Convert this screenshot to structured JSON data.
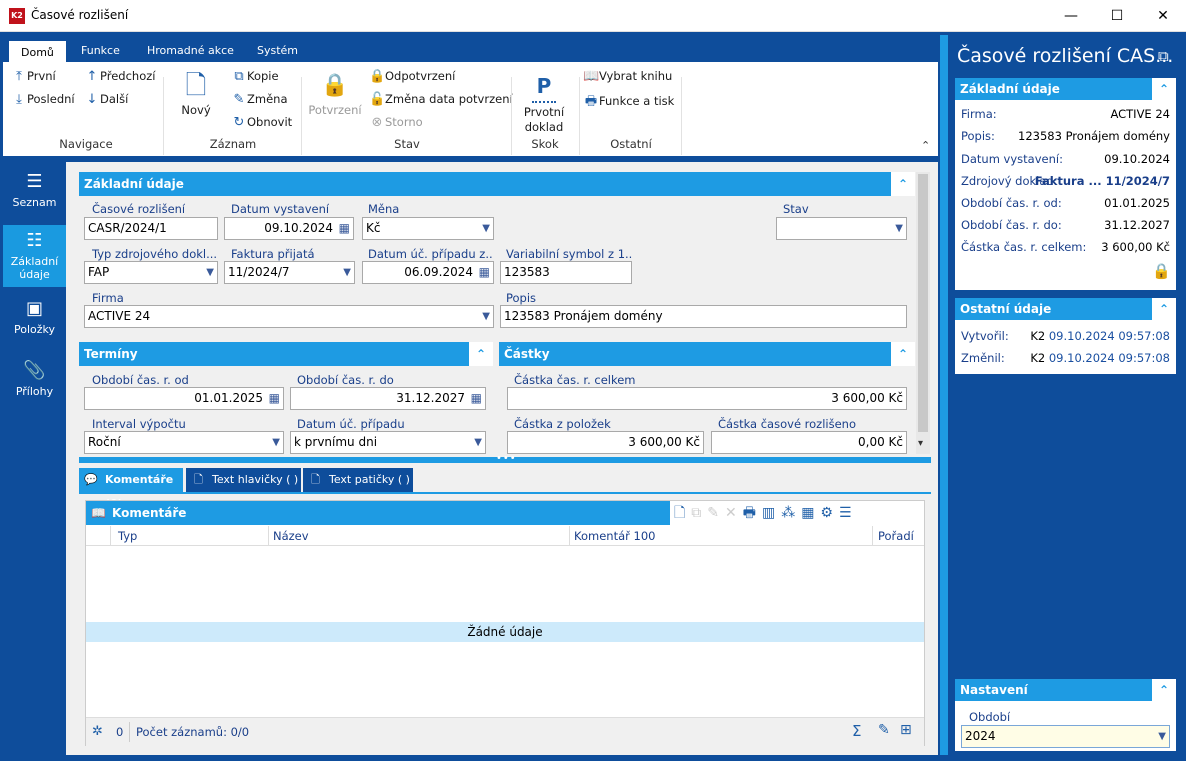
{
  "window": {
    "title": "Časové rozlišení",
    "logo_text": "K2",
    "minimize": "—",
    "maximize": "☐",
    "close": "✕"
  },
  "ribbon": {
    "tabs": [
      {
        "label": "Domů"
      },
      {
        "label": "Funkce"
      },
      {
        "label": "Hromadné akce"
      },
      {
        "label": "Systém"
      }
    ],
    "groups": {
      "navigace": {
        "label": "Navigace",
        "first": "První",
        "last": "Poslední",
        "prev": "Předchozí",
        "next": "Další"
      },
      "zaznam": {
        "label": "Záznam",
        "new": "Nový",
        "copy": "Kopie",
        "change": "Změna",
        "refresh": "Obnovit"
      },
      "stav": {
        "label": "Stav",
        "confirm": "Potvrzení",
        "unconfirm": "Odpotvrzení",
        "change_date": "Změna data potvrzení",
        "storno": "Storno"
      },
      "skok": {
        "label": "Skok",
        "primary_line1": "Prvotní",
        "primary_line2": "doklad",
        "primary_icon_letter": "P"
      },
      "ostatni": {
        "label": "Ostatní",
        "select_book": "Vybrat knihu",
        "functions_print": "Funkce a tisk"
      }
    }
  },
  "nav": [
    {
      "label": "Seznam"
    },
    {
      "label_line1": "Základní",
      "label_line2": "údaje"
    },
    {
      "label": "Položky"
    },
    {
      "label": "Přílohy"
    }
  ],
  "basic": {
    "title": "Základní údaje",
    "fields": {
      "casove_rozliseni": {
        "label": "Časové rozlišení",
        "value": "CASR/2024/1"
      },
      "datum_vystaveni": {
        "label": "Datum vystavení",
        "value": "09.10.2024"
      },
      "mena": {
        "label": "Měna",
        "value": "Kč"
      },
      "stav": {
        "label": "Stav",
        "value": ""
      },
      "typ_zdroj": {
        "label": "Typ zdrojového dokl...",
        "value": "FAP"
      },
      "faktura_prijata": {
        "label": "Faktura přijatá",
        "value": "11/2024/7"
      },
      "datum_uc_z": {
        "label": "Datum úč. případu z...",
        "value": "06.09.2024"
      },
      "var_symbol": {
        "label": "Variabilní symbol z 1...",
        "value": "123583"
      },
      "firma": {
        "label": "Firma",
        "value": "ACTIVE 24"
      },
      "popis": {
        "label": "Popis",
        "value": "123583 Pronájem domény"
      }
    }
  },
  "terminy": {
    "title": "Termíny",
    "obdobi_od": {
      "label": "Období čas. r. od",
      "value": "01.01.2025"
    },
    "obdobi_do": {
      "label": "Období čas. r. do",
      "value": "31.12.2027"
    },
    "interval": {
      "label": "Interval výpočtu",
      "value": "Roční"
    },
    "datum_uc": {
      "label": "Datum úč. případu",
      "value": "k prvnímu dni"
    }
  },
  "castky": {
    "title": "Částky",
    "celkem": {
      "label": "Částka čas. r. celkem",
      "value": "3 600,00 Kč"
    },
    "z_polozek": {
      "label": "Částka z položek",
      "value": "3 600,00 Kč"
    },
    "rozliseno": {
      "label": "Částka časové rozlišeno",
      "value": "0,00 Kč"
    }
  },
  "subtabs": [
    {
      "label": "Komentáře (0)"
    },
    {
      "label": "Text hlavičky ( )"
    },
    {
      "label": "Text patičky ( )"
    }
  ],
  "comments": {
    "title": "Komentáře",
    "columns": [
      "Typ",
      "Název",
      "Komentář 100",
      "Pořadí"
    ],
    "empty": "Žádné údaje",
    "footer_count": "0",
    "footer_records": "Počet záznamů: 0/0"
  },
  "rpanel": {
    "title": "Časové rozlišení CAS...",
    "basic": {
      "title": "Základní údaje",
      "rows": [
        {
          "k": "Firma:",
          "v": "ACTIVE 24"
        },
        {
          "k": "Popis:",
          "v": "123583 Pronájem domény"
        },
        {
          "k": "Datum vystavení:",
          "v": "09.10.2024"
        },
        {
          "k": "Zdrojový doklad:",
          "v": "Faktura ...  11/2024/7"
        },
        {
          "k": "Období čas. r. od:",
          "v": "01.01.2025"
        },
        {
          "k": "Období čas. r. do:",
          "v": "31.12.2027"
        },
        {
          "k": "Částka čas. r. celkem:",
          "v": "3 600,00 Kč"
        }
      ]
    },
    "other": {
      "title": "Ostatní údaje",
      "created_label": "Vytvořil:",
      "created_user": "K2",
      "created_date": "09.10.2024 09:57:08",
      "changed_label": "Změnil:",
      "changed_user": "K2",
      "changed_date": "09.10.2024 09:57:08"
    },
    "settings": {
      "title": "Nastavení",
      "period_label": "Období",
      "period_value": "2024"
    }
  },
  "colors": {
    "accent": "#1e9be3",
    "dark": "#0e4d9b",
    "lock_green": "#2bb54a"
  }
}
